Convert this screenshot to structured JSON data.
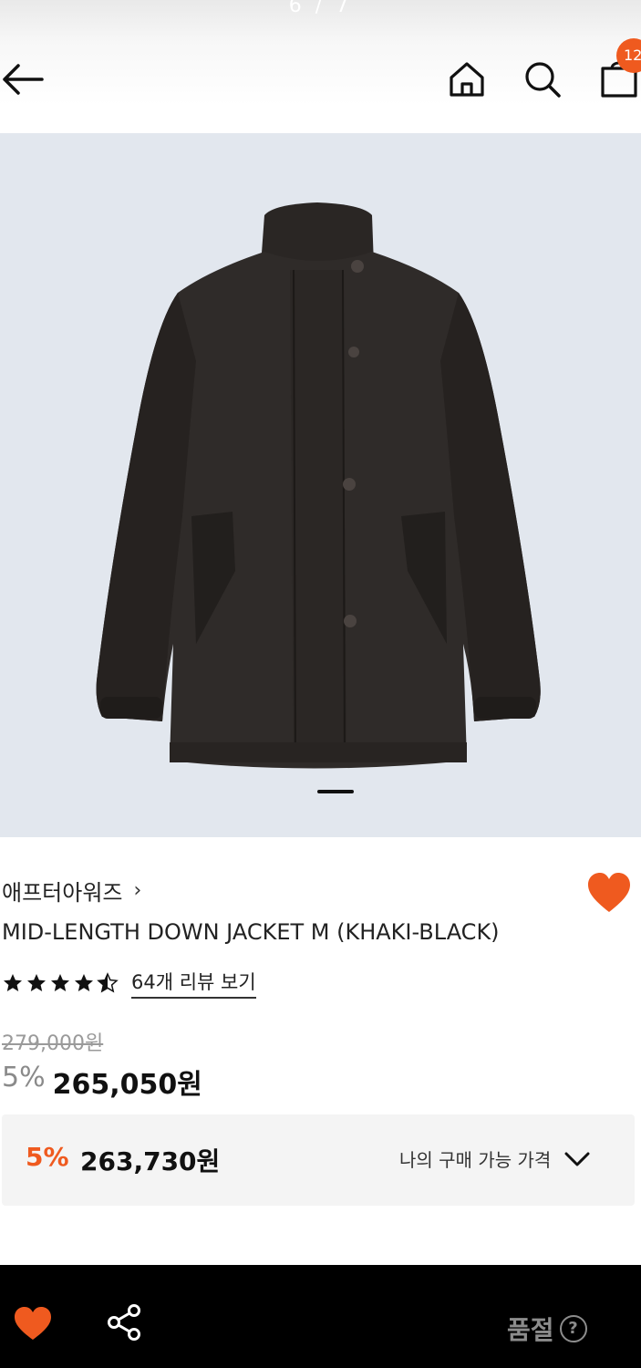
{
  "header": {
    "page_indicator": "6 / 7",
    "cart_count": "12",
    "icons": [
      "back-arrow-icon",
      "home-icon",
      "search-icon",
      "shopping-bag-icon"
    ]
  },
  "product": {
    "brand": "애프터아워즈",
    "brand_chevron": "›",
    "name": "MID-LENGTH DOWN JACKET M (KHAKI-BLACK)",
    "rating": 4.5,
    "review_link": "64개 리뷰 보기",
    "original_price": "279,000원",
    "sale_percent": "5%",
    "sale_price": "265,050원",
    "wishlisted": true
  },
  "member_price": {
    "percent": "5%",
    "price": "263,730원",
    "toggle_label": "나의 구매 가능 가격"
  },
  "bottom_bar": {
    "status_label": "품절",
    "help_glyph": "?"
  },
  "colors": {
    "accent": "#ef5a1f",
    "image_bg": "#e2e7ee",
    "bottom_bar_bg": "#000000"
  }
}
